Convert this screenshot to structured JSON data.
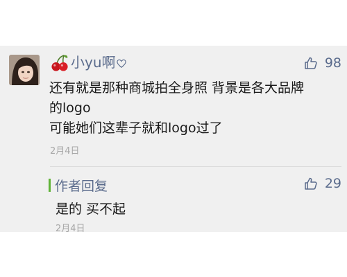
{
  "comment": {
    "username": "小yu啊",
    "likes": "98",
    "lines": [
      "还有就是那种商城拍全身照 背景是各大品牌",
      "的logo",
      "可能她们这辈子就和logo过了"
    ],
    "date": "2月4日"
  },
  "reply": {
    "label": "作者回复",
    "likes": "29",
    "text": "是的 买不起",
    "date": "2月4日"
  },
  "colors": {
    "name_blue": "#5a6b8c",
    "reply_bar_green": "#5fb336",
    "date_gray": "#a6a6a6",
    "card_bg": "#f0f0f0"
  },
  "icons": {
    "username_prefix": "cherry-icon",
    "username_suffix": "heart-icon",
    "like": "thumbs-up-icon"
  }
}
